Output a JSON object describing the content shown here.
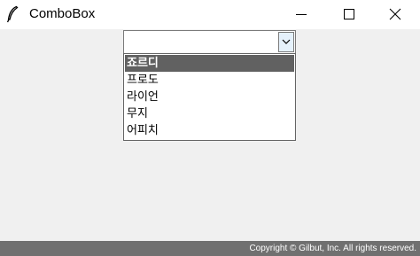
{
  "window": {
    "title": "ComboBox",
    "app_icon": "feather-icon",
    "controls": [
      "minimize-icon",
      "maximize-icon",
      "close-icon"
    ]
  },
  "combobox": {
    "value": "",
    "placeholder": "",
    "arrow_icon": "chevron-down-icon",
    "options": [
      "죠르디",
      "프로도",
      "라이언",
      "무지",
      "어피치"
    ],
    "highlighted_index": 0
  },
  "footer": {
    "copyright": "Copyright © Gilbut, Inc. All rights reserved."
  },
  "colors": {
    "window_bg": "#f0f0f0",
    "titlebar_bg": "#ffffff",
    "highlight_bg": "#616161",
    "highlight_text": "#ffffff",
    "arrow_button_bg": "#e5f1fb",
    "footer_bg": "#707070"
  }
}
